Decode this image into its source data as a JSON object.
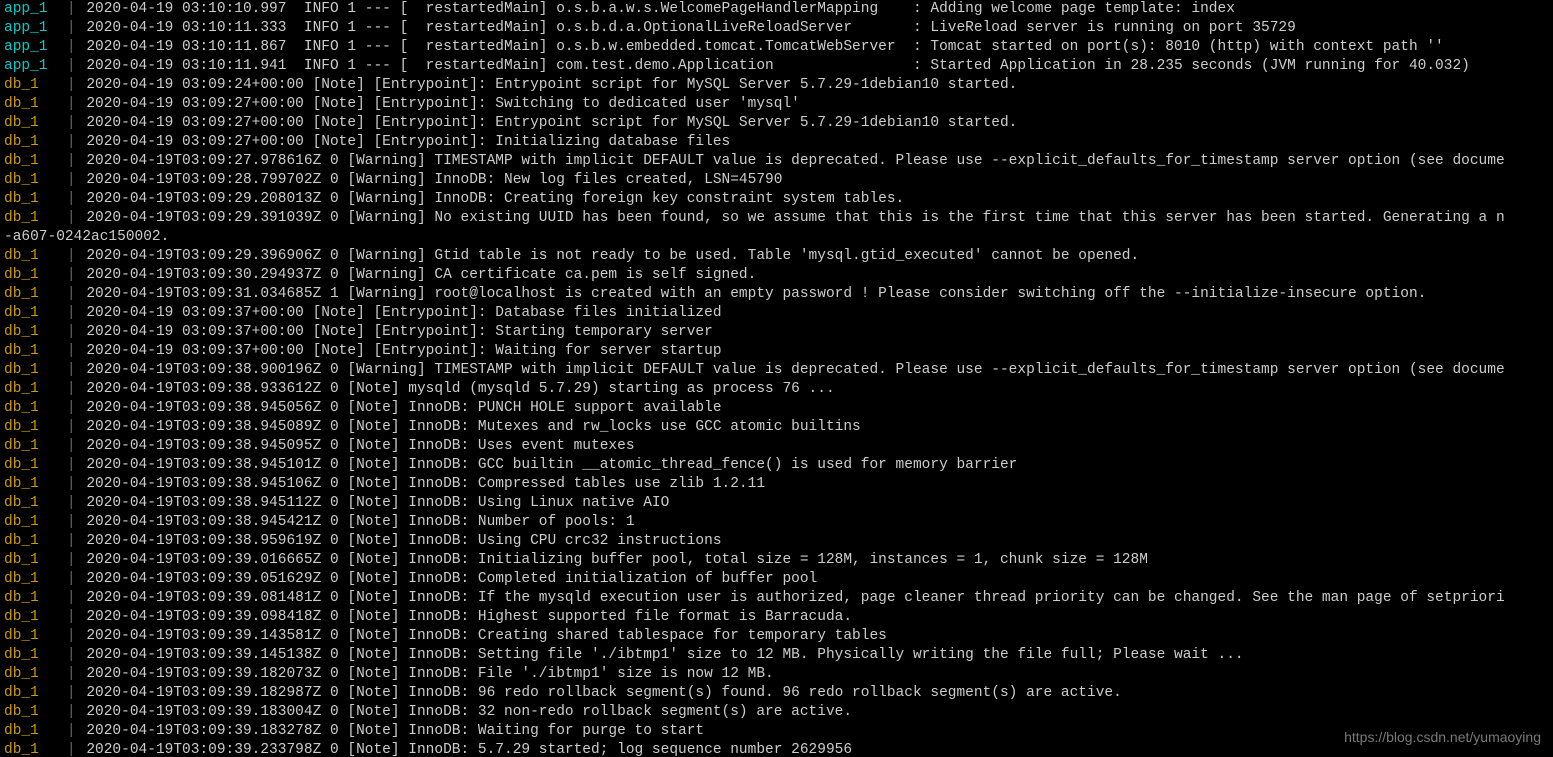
{
  "watermark": "https://blog.csdn.net/yumaoying",
  "lines": [
    {
      "prefix": "app_1",
      "text": "2020-04-19 03:10:10.997  INFO 1 --- [  restartedMain] o.s.b.a.w.s.WelcomePageHandlerMapping    : Adding welcome page template: index"
    },
    {
      "prefix": "app_1",
      "text": "2020-04-19 03:10:11.333  INFO 1 --- [  restartedMain] o.s.b.d.a.OptionalLiveReloadServer       : LiveReload server is running on port 35729"
    },
    {
      "prefix": "app_1",
      "text": "2020-04-19 03:10:11.867  INFO 1 --- [  restartedMain] o.s.b.w.embedded.tomcat.TomcatWebServer  : Tomcat started on port(s): 8010 (http) with context path ''"
    },
    {
      "prefix": "app_1",
      "text": "2020-04-19 03:10:11.941  INFO 1 --- [  restartedMain] com.test.demo.Application                : Started Application in 28.235 seconds (JVM running for 40.032)"
    },
    {
      "prefix": "db_1",
      "text": "2020-04-19 03:09:24+00:00 [Note] [Entrypoint]: Entrypoint script for MySQL Server 5.7.29-1debian10 started."
    },
    {
      "prefix": "db_1",
      "text": "2020-04-19 03:09:27+00:00 [Note] [Entrypoint]: Switching to dedicated user 'mysql'"
    },
    {
      "prefix": "db_1",
      "text": "2020-04-19 03:09:27+00:00 [Note] [Entrypoint]: Entrypoint script for MySQL Server 5.7.29-1debian10 started."
    },
    {
      "prefix": "db_1",
      "text": "2020-04-19 03:09:27+00:00 [Note] [Entrypoint]: Initializing database files"
    },
    {
      "prefix": "db_1",
      "text": "2020-04-19T03:09:27.978616Z 0 [Warning] TIMESTAMP with implicit DEFAULT value is deprecated. Please use --explicit_defaults_for_timestamp server option (see docume"
    },
    {
      "prefix": "db_1",
      "text": "2020-04-19T03:09:28.799702Z 0 [Warning] InnoDB: New log files created, LSN=45790"
    },
    {
      "prefix": "db_1",
      "text": "2020-04-19T03:09:29.208013Z 0 [Warning] InnoDB: Creating foreign key constraint system tables."
    },
    {
      "prefix": "db_1",
      "text": "2020-04-19T03:09:29.391039Z 0 [Warning] No existing UUID has been found, so we assume that this is the first time that this server has been started. Generating a n"
    },
    {
      "wrap": true,
      "text": "-a607-0242ac150002."
    },
    {
      "prefix": "db_1",
      "text": "2020-04-19T03:09:29.396906Z 0 [Warning] Gtid table is not ready to be used. Table 'mysql.gtid_executed' cannot be opened."
    },
    {
      "prefix": "db_1",
      "text": "2020-04-19T03:09:30.294937Z 0 [Warning] CA certificate ca.pem is self signed."
    },
    {
      "prefix": "db_1",
      "text": "2020-04-19T03:09:31.034685Z 1 [Warning] root@localhost is created with an empty password ! Please consider switching off the --initialize-insecure option."
    },
    {
      "prefix": "db_1",
      "text": "2020-04-19 03:09:37+00:00 [Note] [Entrypoint]: Database files initialized"
    },
    {
      "prefix": "db_1",
      "text": "2020-04-19 03:09:37+00:00 [Note] [Entrypoint]: Starting temporary server"
    },
    {
      "prefix": "db_1",
      "text": "2020-04-19 03:09:37+00:00 [Note] [Entrypoint]: Waiting for server startup"
    },
    {
      "prefix": "db_1",
      "text": "2020-04-19T03:09:38.900196Z 0 [Warning] TIMESTAMP with implicit DEFAULT value is deprecated. Please use --explicit_defaults_for_timestamp server option (see docume"
    },
    {
      "prefix": "db_1",
      "text": "2020-04-19T03:09:38.933612Z 0 [Note] mysqld (mysqld 5.7.29) starting as process 76 ..."
    },
    {
      "prefix": "db_1",
      "text": "2020-04-19T03:09:38.945056Z 0 [Note] InnoDB: PUNCH HOLE support available"
    },
    {
      "prefix": "db_1",
      "text": "2020-04-19T03:09:38.945089Z 0 [Note] InnoDB: Mutexes and rw_locks use GCC atomic builtins"
    },
    {
      "prefix": "db_1",
      "text": "2020-04-19T03:09:38.945095Z 0 [Note] InnoDB: Uses event mutexes"
    },
    {
      "prefix": "db_1",
      "text": "2020-04-19T03:09:38.945101Z 0 [Note] InnoDB: GCC builtin __atomic_thread_fence() is used for memory barrier"
    },
    {
      "prefix": "db_1",
      "text": "2020-04-19T03:09:38.945106Z 0 [Note] InnoDB: Compressed tables use zlib 1.2.11"
    },
    {
      "prefix": "db_1",
      "text": "2020-04-19T03:09:38.945112Z 0 [Note] InnoDB: Using Linux native AIO"
    },
    {
      "prefix": "db_1",
      "text": "2020-04-19T03:09:38.945421Z 0 [Note] InnoDB: Number of pools: 1"
    },
    {
      "prefix": "db_1",
      "text": "2020-04-19T03:09:38.959619Z 0 [Note] InnoDB: Using CPU crc32 instructions"
    },
    {
      "prefix": "db_1",
      "text": "2020-04-19T03:09:39.016665Z 0 [Note] InnoDB: Initializing buffer pool, total size = 128M, instances = 1, chunk size = 128M"
    },
    {
      "prefix": "db_1",
      "text": "2020-04-19T03:09:39.051629Z 0 [Note] InnoDB: Completed initialization of buffer pool"
    },
    {
      "prefix": "db_1",
      "text": "2020-04-19T03:09:39.081481Z 0 [Note] InnoDB: If the mysqld execution user is authorized, page cleaner thread priority can be changed. See the man page of setpriori"
    },
    {
      "prefix": "db_1",
      "text": "2020-04-19T03:09:39.098418Z 0 [Note] InnoDB: Highest supported file format is Barracuda."
    },
    {
      "prefix": "db_1",
      "text": "2020-04-19T03:09:39.143581Z 0 [Note] InnoDB: Creating shared tablespace for temporary tables"
    },
    {
      "prefix": "db_1",
      "text": "2020-04-19T03:09:39.145138Z 0 [Note] InnoDB: Setting file './ibtmp1' size to 12 MB. Physically writing the file full; Please wait ..."
    },
    {
      "prefix": "db_1",
      "text": "2020-04-19T03:09:39.182073Z 0 [Note] InnoDB: File './ibtmp1' size is now 12 MB."
    },
    {
      "prefix": "db_1",
      "text": "2020-04-19T03:09:39.182987Z 0 [Note] InnoDB: 96 redo rollback segment(s) found. 96 redo rollback segment(s) are active."
    },
    {
      "prefix": "db_1",
      "text": "2020-04-19T03:09:39.183004Z 0 [Note] InnoDB: 32 non-redo rollback segment(s) are active."
    },
    {
      "prefix": "db_1",
      "text": "2020-04-19T03:09:39.183278Z 0 [Note] InnoDB: Waiting for purge to start"
    },
    {
      "prefix": "db_1",
      "text": "2020-04-19T03:09:39.233798Z 0 [Note] InnoDB: 5.7.29 started; log sequence number 2629956"
    }
  ]
}
